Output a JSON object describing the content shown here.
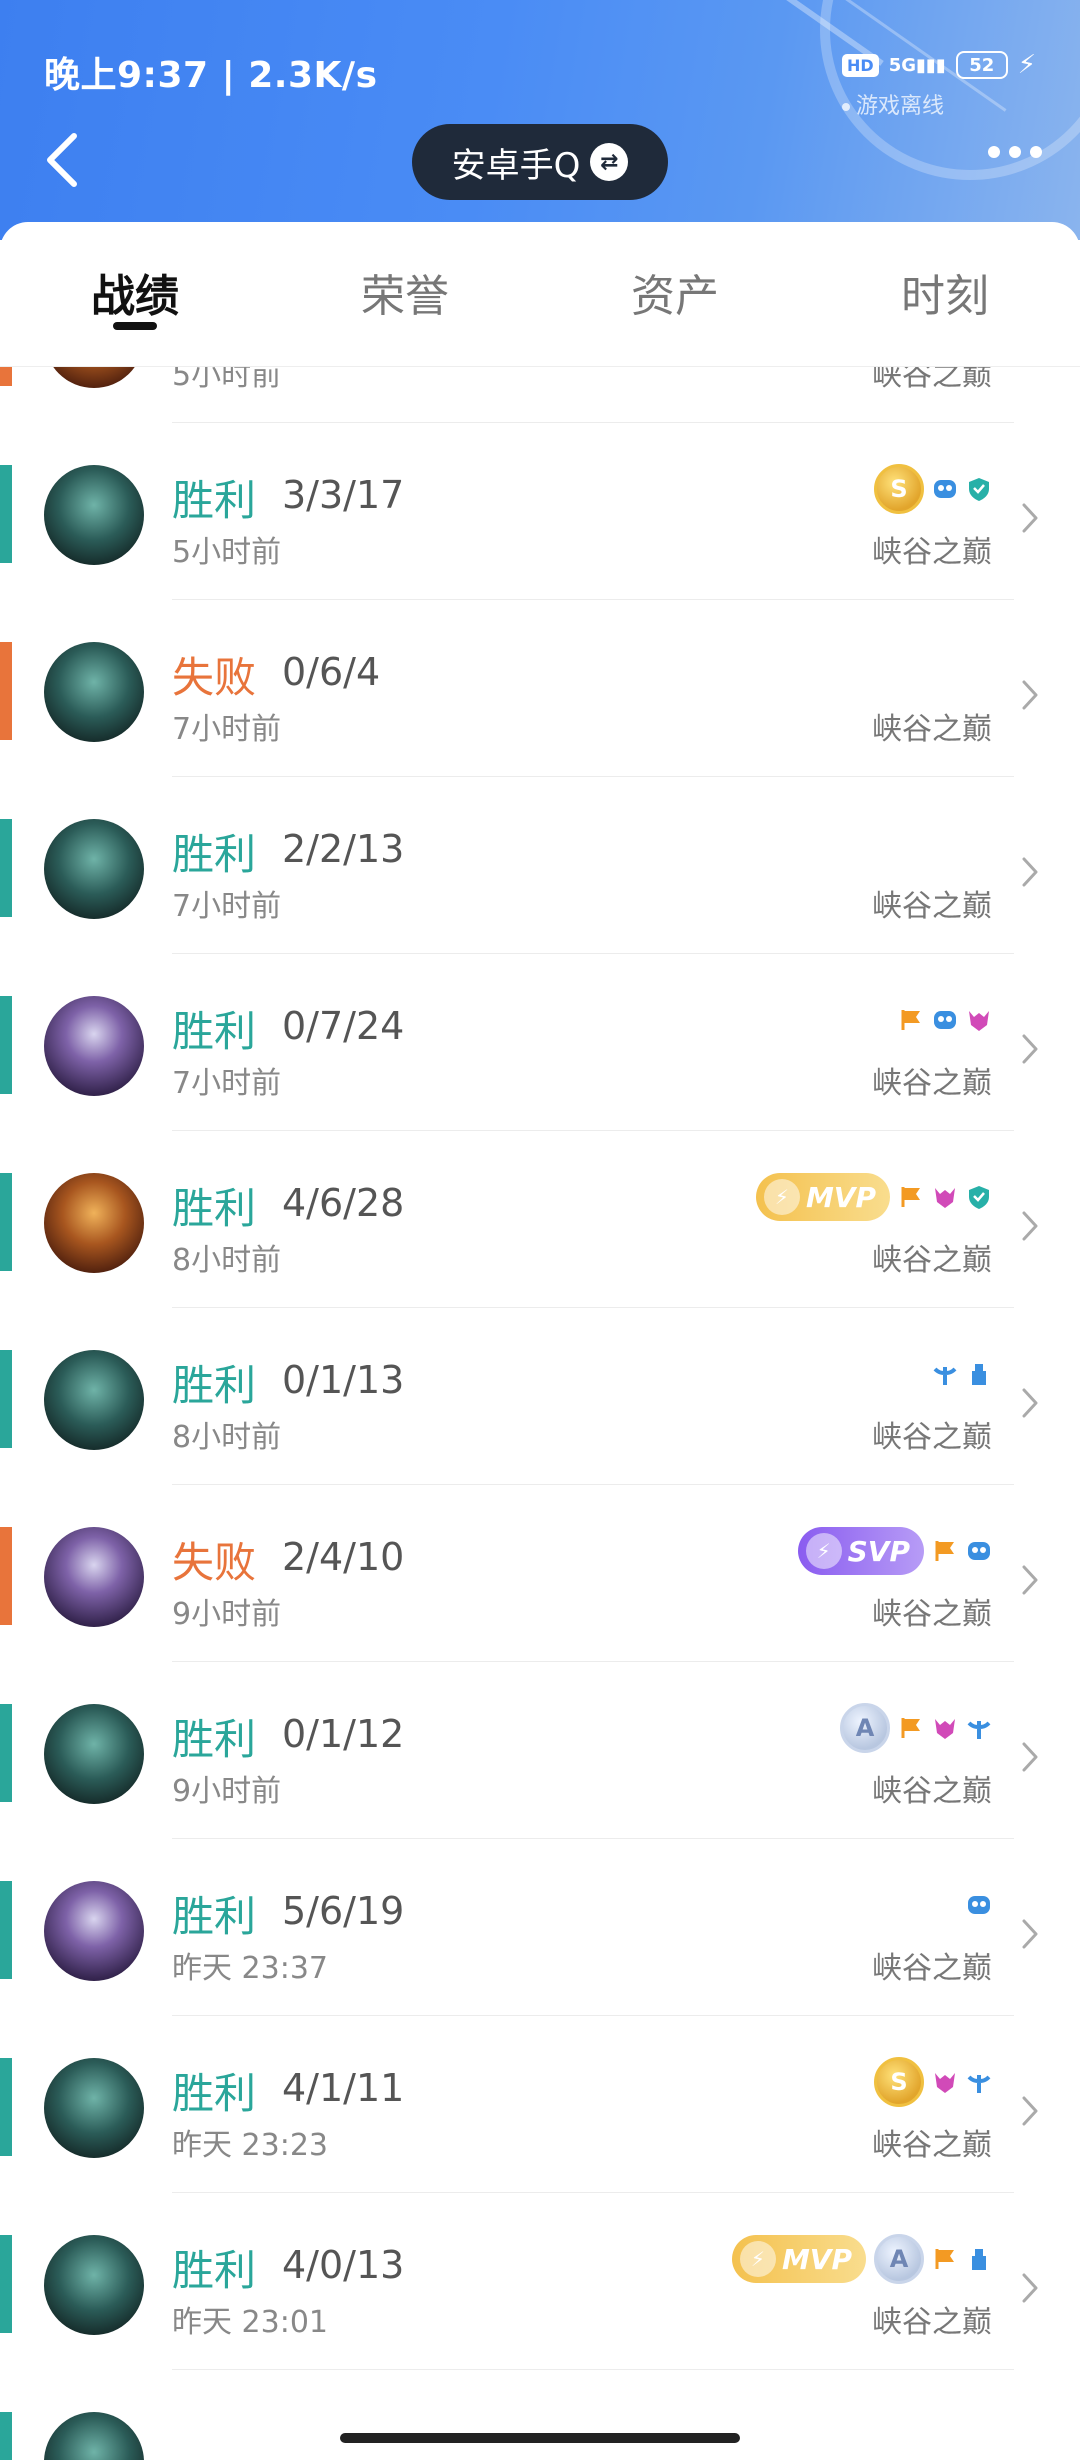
{
  "status_bar": {
    "time_speed": "晚上9:37 | 2.3K/s",
    "hd": "HD",
    "network": "5G",
    "battery": "52",
    "offline_label": "游戏离线"
  },
  "header": {
    "account_label": "安卓手Q",
    "swap_symbol": "⇄"
  },
  "tabs": [
    {
      "label": "战绩",
      "active": true
    },
    {
      "label": "荣誉",
      "active": false
    },
    {
      "label": "资产",
      "active": false
    },
    {
      "label": "时刻",
      "active": false
    }
  ],
  "partial_top": {
    "time": "5小时前",
    "mode": "峡谷之巅"
  },
  "matches": [
    {
      "result": "胜利",
      "kda": "3/3/17",
      "time": "5小时前",
      "mode": "峡谷之巅",
      "badges": [
        "medal-s",
        "mask-blue",
        "shield-teal"
      ],
      "hero": "teal"
    },
    {
      "result": "失败",
      "kda": "0/6/4",
      "time": "7小时前",
      "mode": "峡谷之巅",
      "badges": [],
      "hero": "teal"
    },
    {
      "result": "胜利",
      "kda": "2/2/13",
      "time": "7小时前",
      "mode": "峡谷之巅",
      "badges": [],
      "hero": "teal"
    },
    {
      "result": "胜利",
      "kda": "0/7/24",
      "time": "7小时前",
      "mode": "峡谷之巅",
      "badges": [
        "flag-orange",
        "mask-blue",
        "demon-pink"
      ],
      "hero": "purple"
    },
    {
      "result": "胜利",
      "kda": "4/6/28",
      "time": "8小时前",
      "mode": "峡谷之巅",
      "badges": [
        "mvp-gold",
        "flag-orange",
        "demon-pink",
        "shield-teal"
      ],
      "hero": "gold"
    },
    {
      "result": "胜利",
      "kda": "0/1/13",
      "time": "8小时前",
      "mode": "峡谷之巅",
      "badges": [
        "bird-blue",
        "tower-blue"
      ],
      "hero": "teal"
    },
    {
      "result": "失败",
      "kda": "2/4/10",
      "time": "9小时前",
      "mode": "峡谷之巅",
      "badges": [
        "svp-purple",
        "flag-orange",
        "mask-blue"
      ],
      "hero": "purple"
    },
    {
      "result": "胜利",
      "kda": "0/1/12",
      "time": "9小时前",
      "mode": "峡谷之巅",
      "badges": [
        "medal-a",
        "flag-orange",
        "demon-pink",
        "bird-blue"
      ],
      "hero": "teal"
    },
    {
      "result": "胜利",
      "kda": "5/6/19",
      "time": "昨天 23:37",
      "mode": "峡谷之巅",
      "badges": [
        "mask-blue"
      ],
      "hero": "purple"
    },
    {
      "result": "胜利",
      "kda": "4/1/11",
      "time": "昨天 23:23",
      "mode": "峡谷之巅",
      "badges": [
        "medal-s",
        "demon-pink",
        "bird-blue"
      ],
      "hero": "teal"
    },
    {
      "result": "胜利",
      "kda": "4/0/13",
      "time": "昨天 23:01",
      "mode": "峡谷之巅",
      "badges": [
        "mvp-gold",
        "medal-a",
        "flag-orange",
        "tower-blue"
      ],
      "hero": "teal"
    }
  ],
  "badge_text": {
    "mvp": "MVP",
    "svp": "SVP",
    "medal_s": "S",
    "medal_a": "A"
  },
  "colors": {
    "win": "#2aa69a",
    "loss": "#e8743b",
    "header_blue": "#4a8cf5",
    "pill_dark": "#1f2a3a"
  }
}
